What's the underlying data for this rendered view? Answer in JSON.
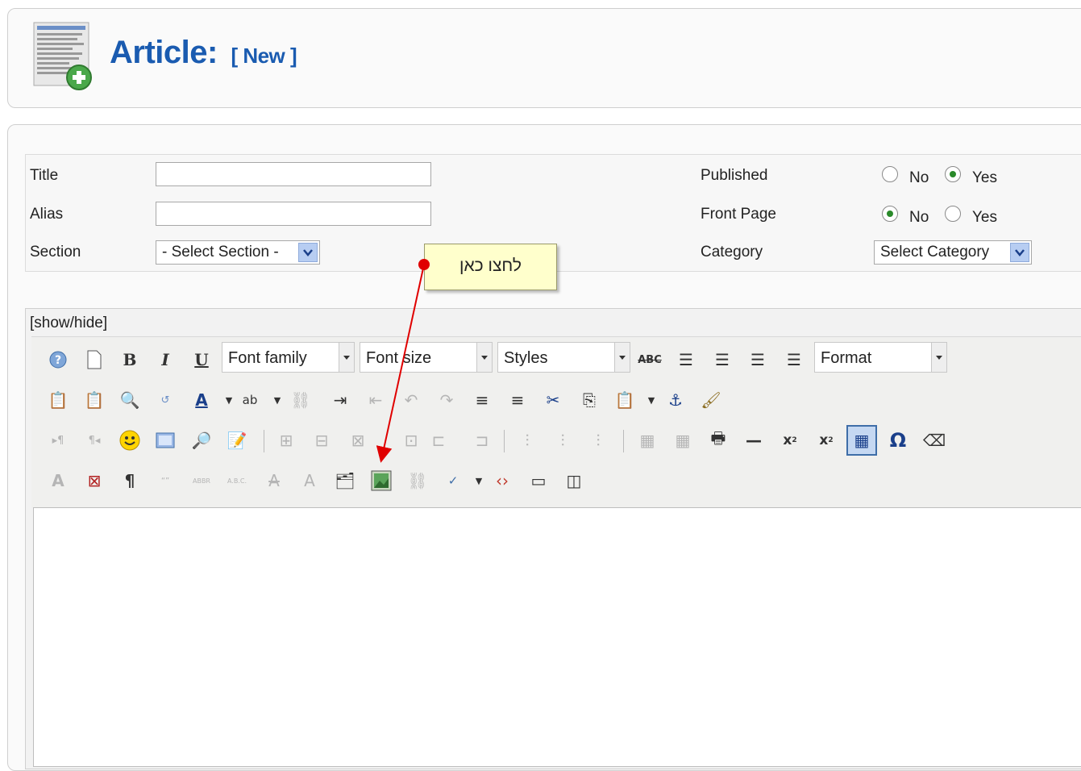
{
  "header": {
    "title": "Article:",
    "status": "[ New ]"
  },
  "details": {
    "title_label": "Title",
    "alias_label": "Alias",
    "section_label": "Section",
    "section_value": "- Select Section -",
    "published_label": "Published",
    "frontpage_label": "Front Page",
    "category_label": "Category",
    "category_value": "Select Category",
    "no": "No",
    "yes": "Yes",
    "published_value": "Yes",
    "frontpage_value": "No"
  },
  "editor": {
    "showhide": "[show/hide]",
    "font_family": "Font family",
    "font_size": "Font size",
    "styles": "Styles",
    "format": "Format"
  },
  "callout": {
    "text": "לחצו כאן"
  },
  "colors": {
    "accent": "#1a5bb0",
    "arrow": "#e00000",
    "callout_bg": "#ffffcc"
  }
}
